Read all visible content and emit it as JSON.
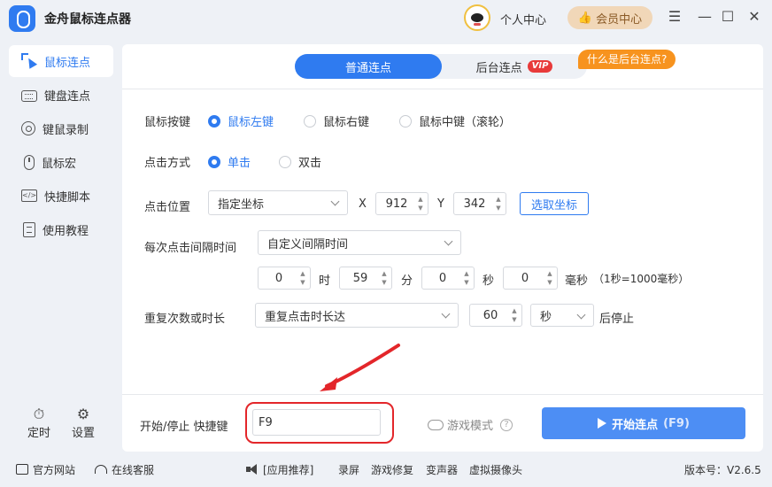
{
  "window": {
    "title": "金舟鼠标连点器",
    "personal_center": "个人中心",
    "member_center": "会员中心",
    "controls": {
      "menu": "☰",
      "minimize": "—",
      "maximize": "☐",
      "close": "✕"
    }
  },
  "sidebar": {
    "items": [
      {
        "label": "鼠标连点",
        "icon": "cursor-click-icon",
        "active": true
      },
      {
        "label": "键盘连点",
        "icon": "keyboard-icon",
        "active": false
      },
      {
        "label": "键鼠录制",
        "icon": "record-icon",
        "active": false
      },
      {
        "label": "鼠标宏",
        "icon": "mouse-icon",
        "active": false
      },
      {
        "label": "快捷脚本",
        "icon": "code-icon",
        "active": false
      },
      {
        "label": "使用教程",
        "icon": "document-icon",
        "active": false
      }
    ],
    "timer_label": "定时",
    "settings_label": "设置"
  },
  "tabs": {
    "normal": "普通连点",
    "background": "后台连点",
    "vip": "VIP",
    "bubble": "什么是后台连点?"
  },
  "mouse_button": {
    "label": "鼠标按键",
    "options": [
      "鼠标左键",
      "鼠标右键",
      "鼠标中键（滚轮）"
    ],
    "selected": 0
  },
  "click_mode": {
    "label": "点击方式",
    "options": [
      "单击",
      "双击"
    ],
    "selected": 0
  },
  "click_position": {
    "label": "点击位置",
    "mode": "指定坐标",
    "x_label": "X",
    "x_value": "912",
    "y_label": "Y",
    "y_value": "342",
    "pick_button": "选取坐标"
  },
  "interval": {
    "label": "每次点击间隔时间",
    "mode": "自定义间隔时间",
    "hours": "0",
    "hours_unit": "时",
    "minutes": "59",
    "minutes_unit": "分",
    "seconds": "0",
    "seconds_unit": "秒",
    "ms": "0",
    "ms_unit": "毫秒",
    "note": "（1秒=1000毫秒）"
  },
  "repeat": {
    "label": "重复次数或时长",
    "mode": "重复点击时长达",
    "value": "60",
    "unit": "秒",
    "suffix": "后停止"
  },
  "hotkey": {
    "label": "开始/停止 快捷键",
    "value": "F9"
  },
  "game_mode": {
    "label": "游戏模式",
    "help": "?"
  },
  "start_button": {
    "label": "开始连点",
    "hotkey": "(F9)"
  },
  "footer": {
    "official_site": "官方网站",
    "online_service": "在线客服",
    "app_recommend": "[应用推荐]",
    "links": [
      "录屏",
      "游戏修复",
      "变声器",
      "虚拟摄像头"
    ],
    "version": "版本号：V2.6.5"
  },
  "colors": {
    "accent": "#2f7bf0",
    "bubble": "#f7931e",
    "highlight_ring": "#e3262a",
    "vip": "#e83a3a"
  }
}
